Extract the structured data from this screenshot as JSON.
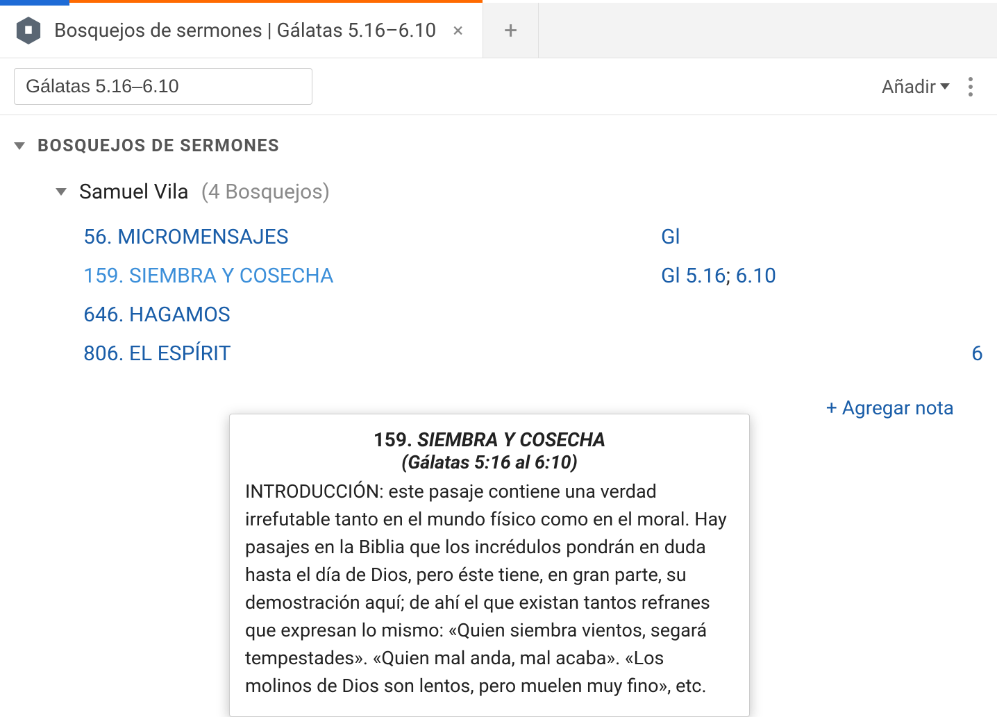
{
  "tab": {
    "title": "Bosquejos de sermones | Gálatas 5.16–6.10"
  },
  "toolbar": {
    "reference": "Gálatas 5.16–6.10",
    "add_label": "Añadir"
  },
  "section": {
    "title": "BOSQUEJOS DE SERMONES"
  },
  "author": {
    "name": "Samuel Vila",
    "count_label": "(4 Bosquejos)"
  },
  "outlines": [
    {
      "title": "56. MICROMENSAJES",
      "ref1": "Gl",
      "sep": "",
      "ref2": ""
    },
    {
      "title": "159. SIEMBRA Y COSECHA",
      "ref1": "Gl 5.16",
      "sep": "; ",
      "ref2": "6.10",
      "active": true
    },
    {
      "title": "646. HAGAMOS",
      "ref1": "",
      "sep": "",
      "ref2": ""
    },
    {
      "title": "806. EL ESPÍRIT",
      "ref1": "",
      "sep": "",
      "ref2": "6",
      "trailing_ref": true
    }
  ],
  "add_note": "+ Agregar nota",
  "popover": {
    "title_num": "159. ",
    "title_text": "SIEMBRA Y COSECHA",
    "subtitle": "(Gálatas 5:16 al 6:10)",
    "body": "INTRODUCCIÓN: este pasaje contiene una verdad irrefutable tanto en el mundo físico como en el moral. Hay pasajes en la Biblia que los incrédulos pondrán en duda hasta el día de Dios, pero éste tiene, en gran parte, su demostración aquí; de ahí el que existan tantos refranes que expresan lo mismo: «Quien siembra vientos, segará tempestades». «Quien mal anda, mal acaba». «Los molinos de Dios son lentos, pero muelen muy fino», etc."
  }
}
